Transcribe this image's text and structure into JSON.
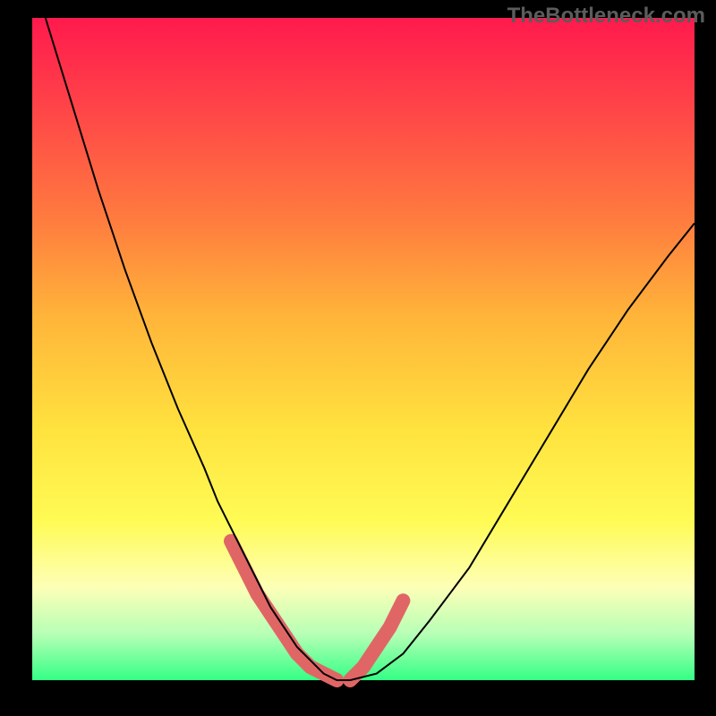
{
  "watermark": "TheBottleneck.com",
  "chart_data": {
    "type": "line",
    "title": "",
    "xlabel": "",
    "ylabel": "",
    "xlim": [
      0,
      100
    ],
    "ylim": [
      0,
      100
    ],
    "grid": false,
    "series": [
      {
        "name": "bottleneck-curve",
        "x": [
          2,
          6,
          10,
          14,
          18,
          22,
          26,
          28,
          30,
          32,
          34,
          36,
          38,
          40,
          42,
          44,
          46,
          48,
          52,
          56,
          60,
          66,
          72,
          78,
          84,
          90,
          96,
          100
        ],
        "y": [
          100,
          87,
          74,
          62,
          51,
          41,
          32,
          27,
          23,
          19,
          15,
          11,
          8,
          5,
          3,
          1,
          0,
          0,
          1,
          4,
          9,
          17,
          27,
          37,
          47,
          56,
          64,
          69
        ]
      }
    ],
    "annotations": [
      {
        "name": "highlight-left",
        "x": [
          30,
          32,
          34,
          36,
          38,
          40,
          42,
          44,
          46
        ],
        "y": [
          21,
          17,
          13,
          10,
          7,
          4,
          2,
          1,
          0
        ]
      },
      {
        "name": "highlight-right",
        "x": [
          48,
          50,
          52,
          54,
          56
        ],
        "y": [
          0,
          2,
          5,
          8,
          12
        ]
      }
    ]
  }
}
